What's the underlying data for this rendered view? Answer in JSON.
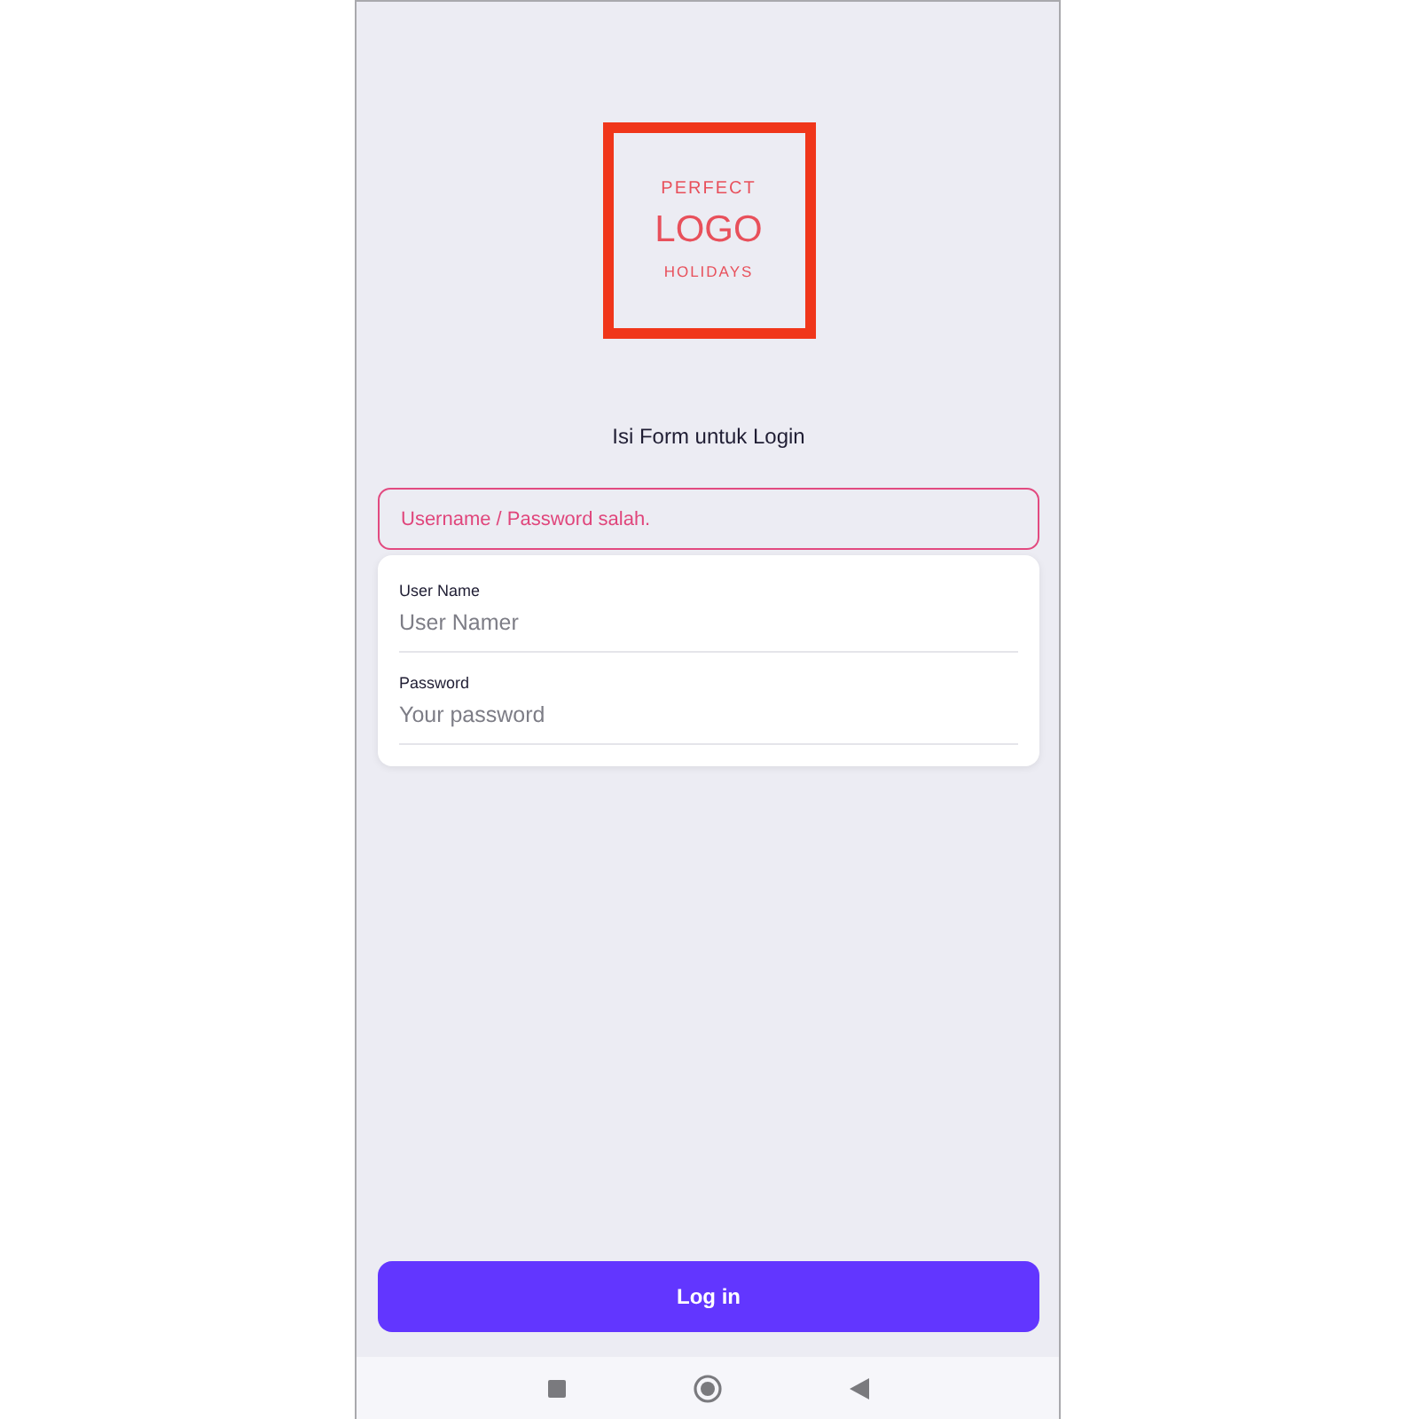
{
  "logo": {
    "tagline": "PERFECT",
    "wordmark": "LOGO",
    "subtitle": "HOLIDAYS"
  },
  "form_title": "Isi Form untuk Login",
  "error_message": "Username / Password salah.",
  "fields": [
    {
      "label": "User Name",
      "placeholder": "User Namer"
    },
    {
      "label": "Password",
      "placeholder": "Your password"
    }
  ],
  "login_button": "Log in"
}
